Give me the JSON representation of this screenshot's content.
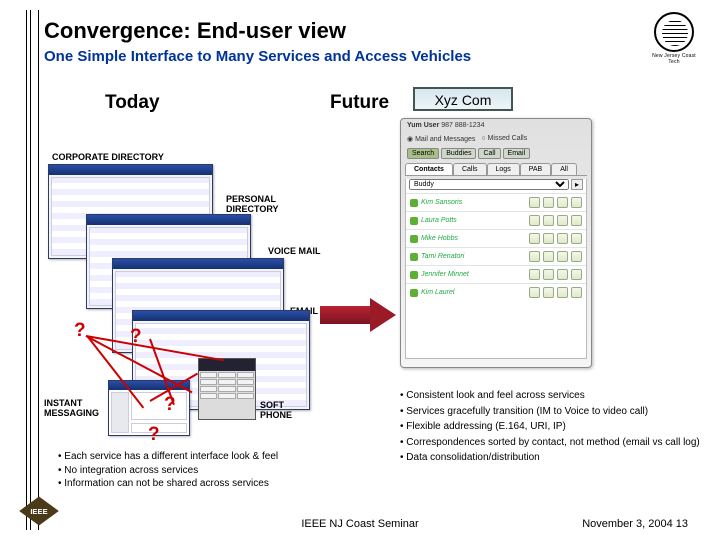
{
  "title": "Convergence: End-user view",
  "subtitle": "One Simple Interface to Many Services and Access Vehicles",
  "headers": {
    "today": "Today",
    "future": "Future"
  },
  "future_app": {
    "brand": "Xyz Com",
    "user_line_label": "Yum User",
    "user_line_value": "987 888-1234",
    "radio1": "Mail and Messages",
    "radio2": "Missed Calls",
    "buttons": [
      "Search",
      "Buddies",
      "Call",
      "Email"
    ],
    "tabs": [
      "Contacts",
      "Calls",
      "Logs",
      "PAB",
      "All"
    ],
    "dropdown": "Buddy",
    "contacts": [
      "Kim Sansoris",
      "Laura Potts",
      "Mike Hobbs",
      "Tami Renatori",
      "Jennifer Minnet",
      "Kim Laurel"
    ],
    "contact_actions": [
      "call",
      "chat",
      "IM",
      "mail"
    ]
  },
  "labels": {
    "corp_dir": "CORPORATE DIRECTORY",
    "pers_dir": "PERSONAL\nDIRECTORY",
    "voice_mail": "VOICE MAIL",
    "email": "EMAIL",
    "soft_phone": "SOFT\nPHONE",
    "im": "INSTANT\nMESSAGING"
  },
  "qmarks": [
    "?",
    "?",
    "?",
    "?"
  ],
  "today_bullets": [
    "Each service has a different interface look & feel",
    "No integration across services",
    "Information can not be shared across services"
  ],
  "future_bullets": [
    "Consistent look and feel across services",
    "Services gracefully transition (IM to Voice to video call)",
    "Flexible addressing (E.164, URI, IP)",
    "Correspondences sorted by contact, not method (email vs call log)",
    "Data consolidation/distribution"
  ],
  "footer": "IEEE NJ Coast Seminar",
  "page_date": "November 3, 2004 13",
  "logo_caption": "New Jersey Coast Tech"
}
